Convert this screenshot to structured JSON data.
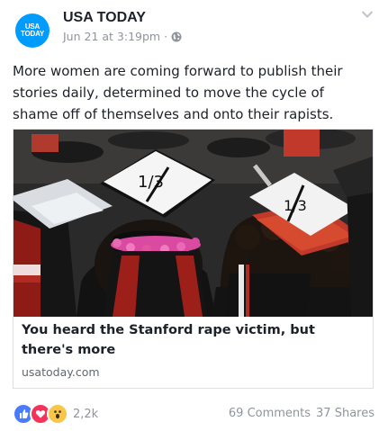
{
  "post": {
    "page_name": "USA TODAY",
    "avatar_line1": "USA",
    "avatar_line2": "TODAY",
    "timestamp": "Jun 21 at 3:19pm",
    "separator": "·",
    "privacy_icon": "globe-icon",
    "menu_icon": "chevron-down-icon",
    "text": "More women are coming forward to publish their stories daily, determined to move the cycle of shame off of themselves and onto their rapists."
  },
  "link_card": {
    "image_labels": [
      "1/3",
      "1/3"
    ],
    "title": "You heard the Stanford rape victim, but there's more",
    "domain": "usatoday.com"
  },
  "footer": {
    "reaction_icons": [
      "like-icon",
      "love-icon",
      "wow-icon"
    ],
    "reaction_count": "2,2k",
    "comments": "69 Comments",
    "shares": "37 Shares"
  },
  "colors": {
    "brand": "#009bff",
    "like": "#4a7bff",
    "love": "#f5325c",
    "wow": "#f7c64a",
    "meta_text": "#90949c"
  }
}
